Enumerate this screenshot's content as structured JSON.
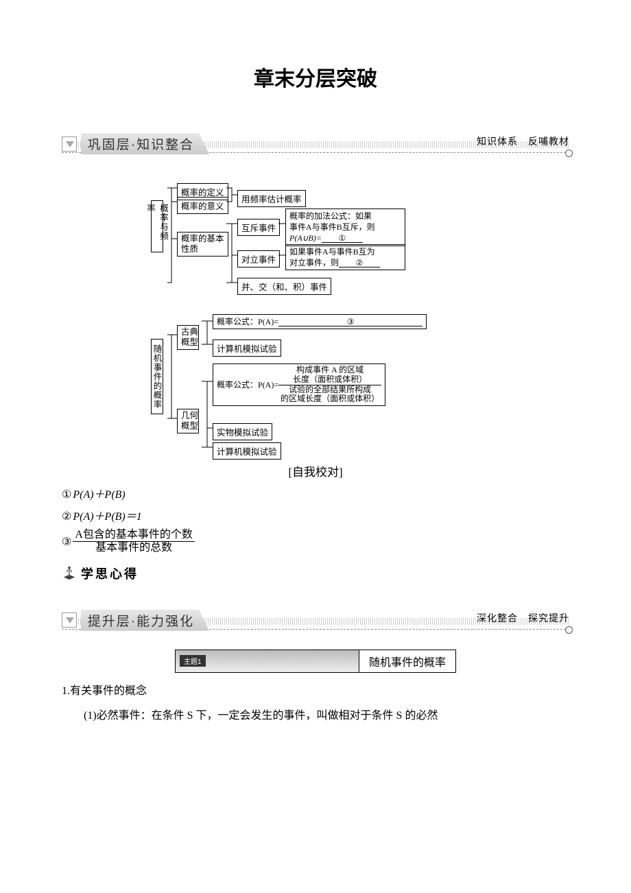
{
  "title": "章末分层突破",
  "section1": {
    "tab": "巩固层·知识整合",
    "right": "知识体系　反哺教材"
  },
  "diagram1": {
    "root": "概率与频率",
    "b1": "概率的定义",
    "b2": "概率的意义",
    "b3a": "概率的基本",
    "b3b": "性质",
    "r1": "用频率估计概率",
    "mut": "互斥事件",
    "mut_text_a": "概率的加法公式：如果",
    "mut_text_b": "事件A与事件B互斥，则",
    "mut_text_c": "P(A∪B)=",
    "mut_blank": "①",
    "opp": "对立事件",
    "opp_text_a": "如果事件A与事件B互为",
    "opp_text_b": "对立事件，则",
    "opp_blank": "②",
    "union": "并、交（和、积）事件"
  },
  "diagram2": {
    "root": "随机事件的概率",
    "gd": "古典概型",
    "gd_r1a": "概率公式：P(A)=",
    "gd_r1_blank": "③",
    "gd_r2": "计算机模拟试验",
    "jh": "几何概型",
    "jh_r1a": "概率公式：P(A)=",
    "jh_frac_num_a": "构成事件 A 的区域",
    "jh_frac_num_b": "长度（面积或体积）",
    "jh_frac_den_a": "试验的全部结果所构成",
    "jh_frac_den_b": "的区域长度（面积或体积）",
    "jh_r2": "实物模拟试验",
    "jh_r3": "计算机模拟试验"
  },
  "self_check": "[自我校对]",
  "answers": {
    "a1a": "①",
    "a1b": "P(A)＋P(B)",
    "a2a": "②",
    "a2b": "P(A)＋P(B)＝1",
    "a3a": "③",
    "a3_num": "A包含的基本事件的个数",
    "a3_den": "基本事件的总数"
  },
  "xuesi": "学思心得",
  "section2": {
    "tab": "提升层·能力强化",
    "right": "深化整合　探究提升"
  },
  "topic": {
    "badge": "主题1",
    "title": "随机事件的概率"
  },
  "body": {
    "h1": "1.有关事件的概念",
    "p1": "(1)必然事件：在条件 S 下，一定会发生的事件，叫做相对于条件 S 的必然"
  }
}
